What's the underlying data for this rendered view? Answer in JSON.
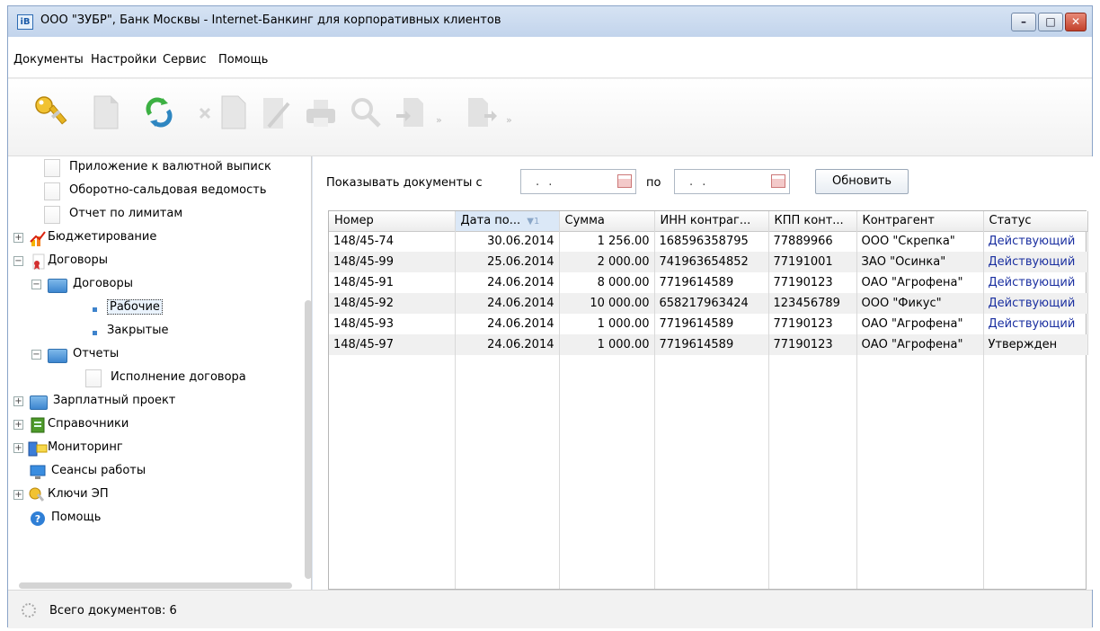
{
  "window": {
    "title": "ООО \"ЗУБР\", Банк Москвы - Internet-Банкинг для корпоративных клиентов"
  },
  "menu": [
    "Документы",
    "Настройки",
    "Сервис",
    "Помощь"
  ],
  "toolbar": {
    "tools": [
      "keys-icon",
      "new-document-icon",
      "refresh-icon",
      "delete-icon",
      "edit-icon",
      "print-icon",
      "search-icon",
      "import-icon",
      "export-icon"
    ]
  },
  "tree": {
    "items": [
      {
        "label": "Приложение к валютной выписк"
      },
      {
        "label": "Оборотно-сальдовая ведомость"
      },
      {
        "label": "Отчет по лимитам"
      },
      {
        "label": "Бюджетирование"
      },
      {
        "label": "Договоры"
      },
      {
        "label": "Договоры"
      },
      {
        "label": "Рабочие"
      },
      {
        "label": "Закрытые"
      },
      {
        "label": "Отчеты"
      },
      {
        "label": "Исполнение договора"
      },
      {
        "label": "Зарплатный проект"
      },
      {
        "label": "Справочники"
      },
      {
        "label": "Мониторинг"
      },
      {
        "label": "Сеансы работы"
      },
      {
        "label": "Ключи ЭП"
      },
      {
        "label": "Помощь"
      }
    ]
  },
  "filter": {
    "label": "Показывать документы с",
    "from_value": ". .",
    "to_label": "по",
    "to_value": ". .",
    "refresh_label": "Обновить"
  },
  "table": {
    "headers": [
      "Номер",
      "Дата по...",
      "Сумма",
      "ИНН контраг...",
      "КПП конт...",
      "Контрагент",
      "Статус"
    ],
    "sort_marker": "▼1",
    "rows": [
      [
        "148/45-74",
        "30.06.2014",
        "1 256.00",
        "168596358795",
        "77889966",
        "ООО \"Скрепка\"",
        "Действующий"
      ],
      [
        "148/45-99",
        "25.06.2014",
        "2 000.00",
        "741963654852",
        "77191001",
        "ЗАО \"Осинка\"",
        "Действующий"
      ],
      [
        "148/45-91",
        "24.06.2014",
        "8 000.00",
        "7719614589",
        "77190123",
        "ОАО \"Агрофена\"",
        "Действующий"
      ],
      [
        "148/45-92",
        "24.06.2014",
        "10 000.00",
        "658217963424",
        "123456789",
        "ООО \"Фикус\"",
        "Действующий"
      ],
      [
        "148/45-93",
        "24.06.2014",
        "1 000.00",
        "7719614589",
        "77190123",
        "ОАО \"Агрофена\"",
        "Действующий"
      ],
      [
        "148/45-97",
        "24.06.2014",
        "1 000.00",
        "7719614589",
        "77190123",
        "ОАО \"Агрофена\"",
        "Утвержден"
      ]
    ]
  },
  "status": {
    "text": "Всего документов: 6"
  },
  "colors": {
    "status_active": "#1a2fa0",
    "selection": "#eaf3fd"
  }
}
